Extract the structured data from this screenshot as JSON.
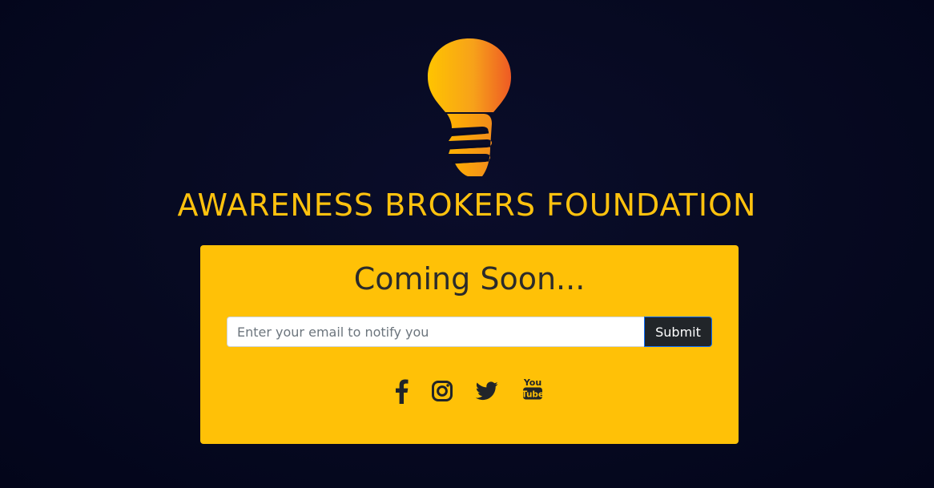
{
  "brand": {
    "logo_icon": "lightbulb-hand-logo",
    "title": "AWARENESS BROKERS FOUNDATION",
    "title_color": "#ffc20e"
  },
  "card": {
    "background_color": "#ffc107",
    "heading": "Coming Soon...",
    "email_placeholder": "Enter your email to notify you",
    "email_value": "",
    "submit_label": "Submit"
  },
  "social": [
    {
      "icon": "facebook-icon"
    },
    {
      "icon": "instagram-icon"
    },
    {
      "icon": "twitter-icon"
    },
    {
      "icon": "youtube-icon",
      "text_top": "You",
      "text_bottom": "Tube"
    }
  ],
  "colors": {
    "background": "#050820",
    "icon": "#212529",
    "button": "#212529"
  }
}
